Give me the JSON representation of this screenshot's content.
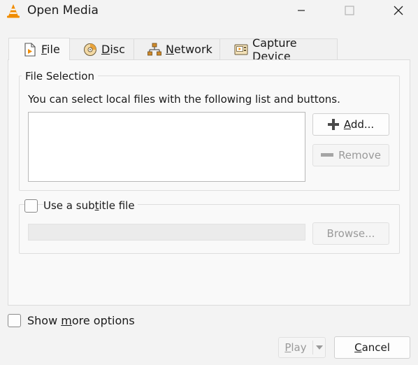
{
  "window": {
    "title": "Open Media",
    "icon": "vlc-cone-icon"
  },
  "tabs": [
    {
      "label": "File",
      "mnemonic": "F",
      "rest": "ile",
      "icon": "file-play-icon",
      "active": true
    },
    {
      "label": "Disc",
      "mnemonic": "D",
      "rest": "isc",
      "icon": "disc-icon",
      "active": false
    },
    {
      "label": "Network",
      "mnemonic": "N",
      "rest": "etwork",
      "icon": "network-icon",
      "active": false
    },
    {
      "label": "Capture Device",
      "pre": "Capture ",
      "mnemonic": "D",
      "rest": "evice",
      "icon": "capture-device-icon",
      "active": false
    }
  ],
  "file_selection": {
    "title": "File Selection",
    "hint": "You can select local files with the following list and buttons.",
    "files": [],
    "add_button": {
      "label": "Add...",
      "mnemonic": "A",
      "rest": "dd...",
      "enabled": true
    },
    "remove_button": {
      "label": "Remove",
      "enabled": false
    }
  },
  "subtitle": {
    "checkbox_label": "Use a subtitle file",
    "pre": "Use a sub",
    "mnemonic": "t",
    "rest": "itle file",
    "checked": false,
    "path_value": "",
    "browse_label": "Browse..."
  },
  "show_more": {
    "label": "Show more options",
    "pre": "Show ",
    "mnemonic": "m",
    "rest": "ore options",
    "checked": false
  },
  "footer": {
    "play_label": "Play",
    "play_mnemonic": "P",
    "play_rest": "lay",
    "play_enabled": false,
    "cancel_label": "Cancel",
    "cancel_mnemonic": "C",
    "cancel_rest": "ancel"
  },
  "colors": {
    "vlc_orange": "#f08c00",
    "panel_bg": "#f9f9f9",
    "window_bg": "#f3f3f3",
    "disabled_text": "#9a9a9a"
  }
}
